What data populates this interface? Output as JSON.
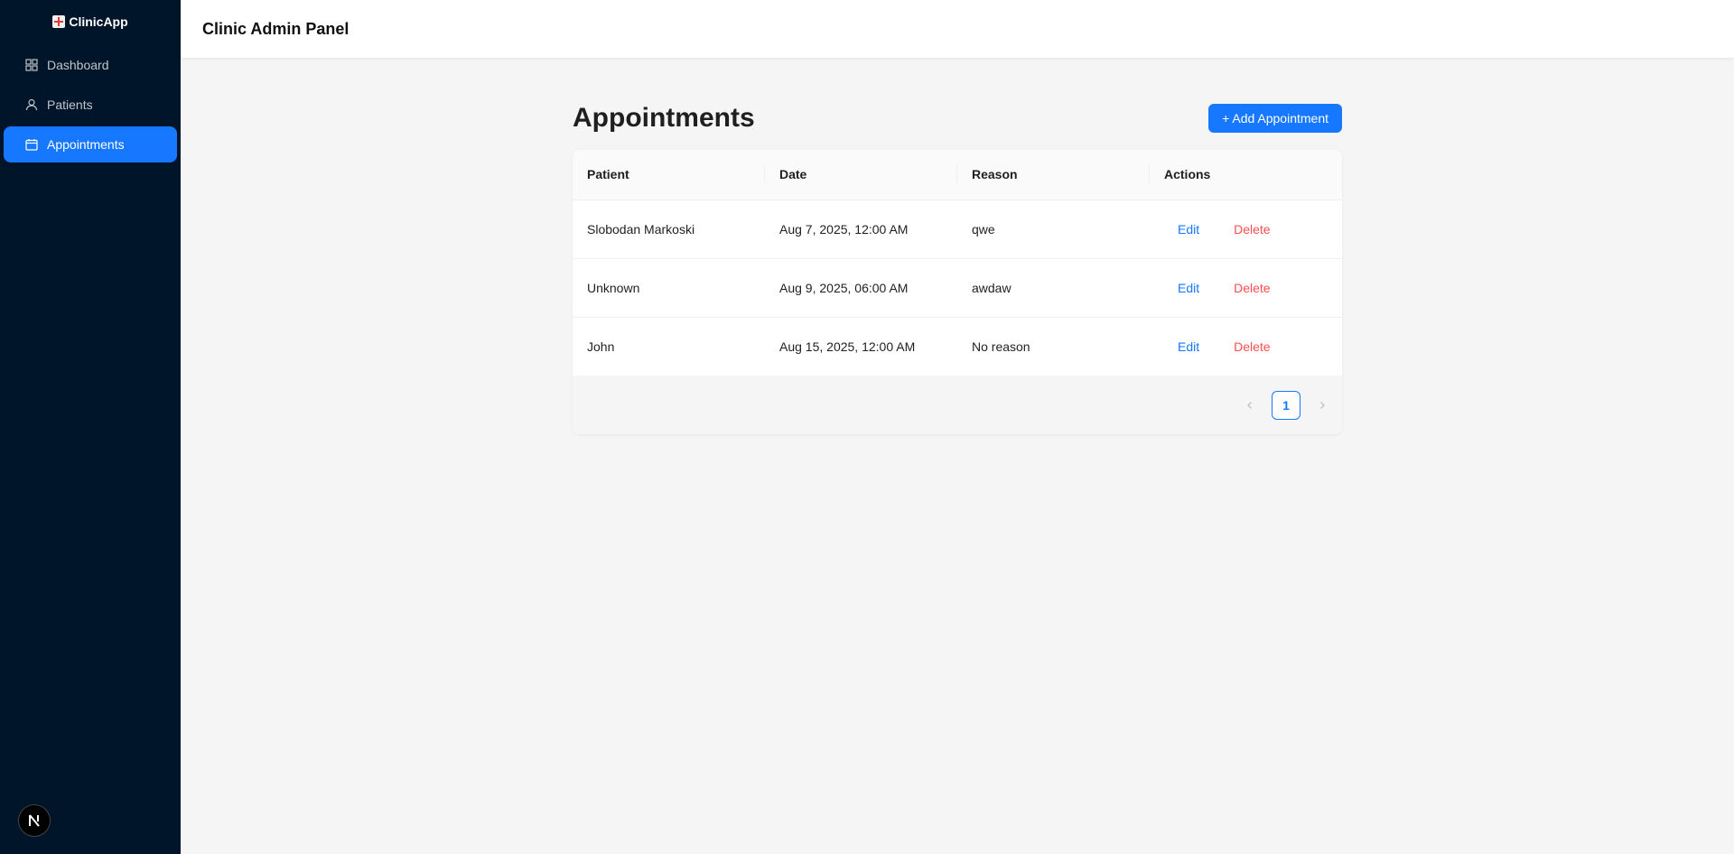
{
  "app": {
    "brand": "ClinicApp",
    "header_title": "Clinic Admin Panel"
  },
  "sidebar": {
    "items": [
      {
        "label": "Dashboard",
        "icon": "dashboard-icon",
        "active": false
      },
      {
        "label": "Patients",
        "icon": "user-icon",
        "active": false
      },
      {
        "label": "Appointments",
        "icon": "calendar-icon",
        "active": true
      }
    ]
  },
  "main": {
    "title": "Appointments",
    "add_button": "+ Add Appointment",
    "columns": [
      "Patient",
      "Date",
      "Reason",
      "Actions"
    ],
    "rows": [
      {
        "patient": "Slobodan Markoski",
        "date": "Aug 7, 2025, 12:00 AM",
        "reason": "qwe",
        "edit": "Edit",
        "delete": "Delete"
      },
      {
        "patient": "Unknown",
        "date": "Aug 9, 2025, 06:00 AM",
        "reason": "awdaw",
        "edit": "Edit",
        "delete": "Delete"
      },
      {
        "patient": "John",
        "date": "Aug 15, 2025, 12:00 AM",
        "reason": "No reason",
        "edit": "Edit",
        "delete": "Delete"
      }
    ],
    "pagination": {
      "current": "1"
    }
  },
  "colors": {
    "sidebar_bg": "#001529",
    "primary": "#1677ff",
    "danger": "#ff4d4f",
    "page_bg": "#f5f5f5"
  },
  "badge": {
    "icon": "nextjs-icon"
  }
}
